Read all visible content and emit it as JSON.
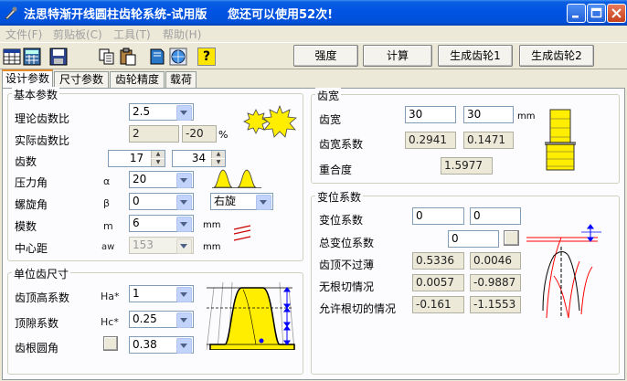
{
  "window": {
    "title": "法思特渐开线圆柱齿轮系统-试用版     您还可以使用52次!",
    "colors": {
      "titlebar": "#0054e3",
      "face": "#ece9d8",
      "panel": "#fcfcfe",
      "accent_yellow": "#ffee00",
      "tab_accent": "#e68b2c"
    }
  },
  "menu": {
    "file": "文件(F)",
    "clipboard": "剪贴板(C)",
    "tools": "工具(T)",
    "help": "帮助(H)"
  },
  "toolbar": {
    "icons": [
      "table-icon",
      "calculator-icon",
      "save-icon",
      "copy-icon",
      "paste-icon",
      "book-icon",
      "globe-icon",
      "help-icon"
    ],
    "help_glyph": "?",
    "strength": "强度",
    "calculate": "计算",
    "gen1": "生成齿轮1",
    "gen2": "生成齿轮2"
  },
  "tabs": [
    "设计参数",
    "尺寸参数",
    "齿轮精度",
    "载荷"
  ],
  "basic": {
    "title": "基本参数",
    "ratio_label": "理论齿数比",
    "ratio_value": "2.5",
    "actual_label": "实际齿数比",
    "actual_value1": "2",
    "actual_value2": "-20",
    "actual_unit": "%",
    "teeth_label": "齿数",
    "teeth1": "17",
    "teeth2": "34",
    "pressure_label": "压力角",
    "pressure_sym": "α",
    "pressure_value": "20",
    "helix_label": "螺旋角",
    "helix_sym": "β",
    "helix_value": "0",
    "hand_value": "右旋",
    "module_label": "模数",
    "module_sym": "m",
    "module_value": "6",
    "module_unit": "mm",
    "center_label": "中心距",
    "center_sym": "aw",
    "center_value": "153",
    "center_unit": "mm"
  },
  "unit": {
    "title": "单位齿尺寸",
    "addendum_label": "齿顶高系数",
    "addendum_sym": "Ha*",
    "addendum_value": "1",
    "clearance_label": "顶隙系数",
    "clearance_sym": "Hc*",
    "clearance_value": "0.25",
    "fillet_label": "齿根圆角",
    "fillet_value": "0.38"
  },
  "width": {
    "title": "齿宽",
    "width_label": "齿宽",
    "width1": "30",
    "width2": "30",
    "width_unit": "mm",
    "coef_label": "齿宽系数",
    "coef1": "0.2941",
    "coef2": "0.1471",
    "overlap_label": "重合度",
    "overlap_value": "1.5977"
  },
  "shift": {
    "title": "变位系数",
    "shift_label": "变位系数",
    "shift1": "0",
    "shift2": "0",
    "total_label": "总变位系数",
    "total_value": "0",
    "tip_label": "齿顶不过薄",
    "tip1": "0.5336",
    "tip2": "0.0046",
    "undercut_label": "无根切情况",
    "undercut1": "0.0057",
    "undercut2": "-0.9887",
    "allow_label": "允许根切的情况",
    "allow1": "-0.161",
    "allow2": "-1.1553"
  }
}
